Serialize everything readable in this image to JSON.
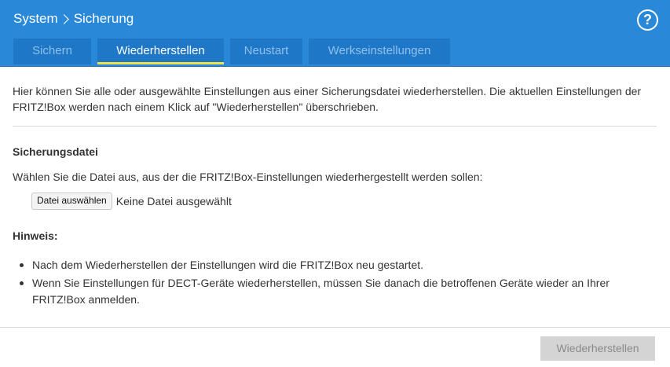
{
  "header": {
    "breadcrumb": [
      "System",
      "Sicherung"
    ],
    "help_label": "?",
    "background_color": "#2a88d8",
    "tab_highlight_color": "#f0e34a"
  },
  "tabs": [
    {
      "label": "Sichern",
      "active": false
    },
    {
      "label": "Wiederherstellen",
      "active": true
    },
    {
      "label": "Neustart",
      "active": false
    },
    {
      "label": "Werkseinstellungen",
      "active": false
    }
  ],
  "intro": "Hier können Sie alle oder ausgewählte Einstellungen aus einer Sicherungsdatei wiederherstellen. Die aktuellen Einstellungen der FRITZ!Box werden nach einem Klick auf \"Wiederherstellen\" überschrieben.",
  "backup_file": {
    "title": "Sicherungsdatei",
    "description": "Wählen Sie die Datei aus, aus der die FRITZ!Box-Einstellungen wiederhergestellt werden sollen:",
    "choose_button": "Datei auswählen",
    "no_file": "Keine Datei ausgewählt"
  },
  "note": {
    "title": "Hinweis:",
    "items": [
      "Nach dem Wiederherstellen der Einstellungen wird die FRITZ!Box neu gestartet.",
      "Wenn Sie Einstellungen für DECT-Geräte wiederherstellen, müssen Sie danach die betroffenen Geräte wieder an Ihrer FRITZ!Box anmelden."
    ]
  },
  "footer": {
    "restore_button": "Wiederherstellen",
    "restore_button_state": "disabled"
  }
}
